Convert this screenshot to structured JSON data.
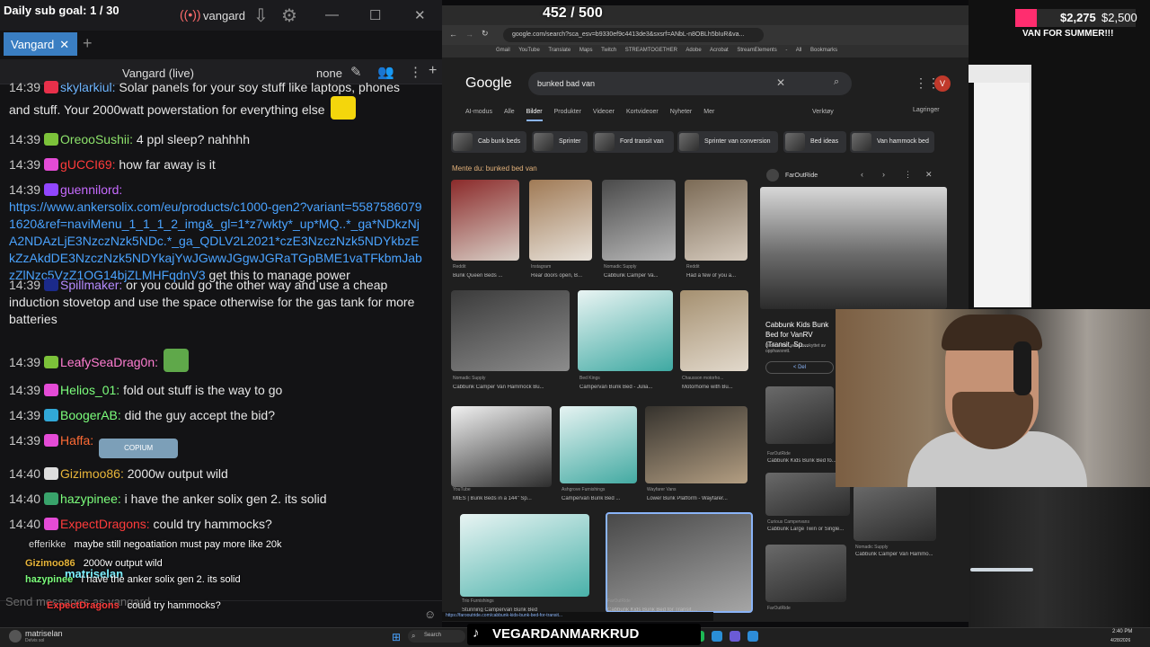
{
  "chatterino": {
    "title": "Daily sub goal: 1 / 30",
    "title_user": "vangard",
    "tab_label": "Vangard",
    "split_title": "Vangard (live)",
    "split_mode": "none",
    "input_placeholder": "Send messages as vangard"
  },
  "chat": [
    {
      "time": "14:39",
      "user": "skylarkiul",
      "user_color": "#6eb5ff",
      "text": "Solar panels for your soy stuff like laptops, phones and stuff. Your 2000watt powerstation for everything else",
      "badge_color": "#e8304a",
      "emote_color": "#f4d60c"
    },
    {
      "time": "14:39",
      "user": "OreooSushii",
      "user_color": "#8de26b",
      "text": "4 ppl sleep? nahhhh",
      "badge_color": "#7cc23a"
    },
    {
      "time": "14:39",
      "user": "gUCCI69",
      "user_color": "#ff3b3b",
      "text": "how far away is it",
      "badge_color": "#e44bd6"
    },
    {
      "time": "14:39",
      "user": "guennilord",
      "user_color": "#c66bff",
      "text": "",
      "link": "https://www.ankersolix.com/eu/products/c1000-gen2?variant=55875860791620&ref=naviMenu_1_1_1_2_img&_gl=1*z7wkty*_up*MQ..*_ga*NDkzNjA2NDAzLjE3NzczNzk5NDc.*_ga_QDLV2L2021*czE3NzczNzk5NDYkbzEkZzAkdDE3NzczNzk5NDYkajYwJGwwJGgwJGRaTGpBME1vaTFkbmJabzZlNzc5VzZ1OG14bjZLMHFqdnV3",
      "text_after": "get this to manage power",
      "badge_color": "#9146ff"
    },
    {
      "time": "14:39",
      "user": "Spillmaker",
      "user_color": "#b68bff",
      "text": "or you could go the other way and use a cheap induction stovetop and use the space otherwise for the gas tank for more batteries",
      "badge_color": "#1b2a8a"
    },
    {
      "time": "14:39",
      "user": "LeafySeaDrag0n",
      "user_color": "#ff7dd1",
      "text": "",
      "badge_color": "#7cc23a",
      "emote_color": "#5fa84a"
    },
    {
      "time": "14:39",
      "user": "Helios_01",
      "user_color": "#7cff7c",
      "text": "fold out stuff is the way to go",
      "badge_color": "#e44bd6"
    },
    {
      "time": "14:39",
      "user": "BoogerAB",
      "user_color": "#7cff7c",
      "text": "did the guy accept the bid?",
      "badge_color": "#31a8d8"
    },
    {
      "time": "14:39",
      "user": "Haffa",
      "user_color": "#ff6b35",
      "text": "",
      "badge_color": "#e44bd6",
      "emote_label": "COPIUM"
    },
    {
      "time": "14:40",
      "user": "Gizimoo86",
      "user_color": "#e8b53a",
      "text": "2000w output wild",
      "badge_color": "#dddddd"
    },
    {
      "time": "14:40",
      "user": "hazypinee",
      "user_color": "#7cff7c",
      "text": "i have the anker solix gen 2. its solid",
      "badge_color": "#39a36b"
    },
    {
      "time": "14:40",
      "user": "ExpectDragons",
      "user_color": "#ff3b3b",
      "text": "could try hammocks?",
      "badge_color": "#e44bd6"
    }
  ],
  "overlay_chat": [
    {
      "user": "efferikke",
      "text": "maybe still negoatiation must pay more like 20k"
    },
    {
      "user": "Gizimoo86",
      "text": "2000w output wild"
    },
    {
      "user": "hazypinee",
      "text": "I have the anker solix gen 2. its solid"
    },
    {
      "user": "ExpectDragons",
      "text": "could try hammocks?"
    }
  ],
  "overlay_top_user": "matriselan",
  "browser": {
    "counter": "452 / 500",
    "url": "google.com/search?sca_esv=b9330ef9c4413de3&sxsrf=ANbL-n8OBLh5bIuR&va...",
    "bookmarks": [
      "Gmail",
      "YouTube",
      "Translate",
      "Maps",
      "Twitch",
      "STREAMTOGETHER",
      "Adobe Acrobat",
      "StreamElements -",
      "All Bookmarks"
    ],
    "status_url": "https://farooutride.com/cabbunk-kids-bunk-bed-for-transit..."
  },
  "google": {
    "logo": "Google",
    "query": "bunked bad van",
    "tabs": [
      "AI-modus",
      "Alle",
      "Bilder",
      "Produkter",
      "Videoer",
      "Kortvideoer",
      "Nyheter",
      "Mer"
    ],
    "active_tab": "Bilder",
    "tools": "Verktøy",
    "save": "Lagringer",
    "chips": [
      "Cab bunk beds",
      "Sprinter",
      "Ford transit van",
      "Sprinter van conversion",
      "Bed ideas",
      "Van hammock bed"
    ],
    "mention": "Mente du: bunked bed van",
    "results": [
      {
        "source": "Reddit",
        "caption": "Bunk Queen Beds ..."
      },
      {
        "source": "Instagram",
        "caption": "Rear doors open, B..."
      },
      {
        "source": "Nomadic Supply",
        "caption": "Cabbunk Camper Va..."
      },
      {
        "source": "Reddit",
        "caption": "Had a few of you a..."
      },
      {
        "source": "Nomadic Supply",
        "caption": "Cabbunk Camper Van Hammock Bu..."
      },
      {
        "source": "Bed Kings",
        "caption": "Campervan Bunk Bed - Julia..."
      },
      {
        "source": "Chausson motorho...",
        "caption": "Motorhome with Bu..."
      },
      {
        "source": "YouTube",
        "caption": "MIES | Bunk Beds in a 144\" Sp..."
      },
      {
        "source": "Ashgrove Furnishings",
        "caption": "Campervan Bunk Bed ..."
      },
      {
        "source": "Wayfarer Vans",
        "caption": "Lower Bunk Platform - Wayfarer..."
      },
      {
        "source": "Trio Furnishings",
        "caption": "Stunning Campervan Bunk Bed"
      },
      {
        "source": "FarOutRide",
        "caption": "Cabbunk Kids Bunk Bed for Transit,..."
      }
    ],
    "panel": {
      "source": "FarOutRide",
      "title": "Cabbunk Kids Bunk Bed for VanRV (Transit, Sp...",
      "note": "Bildene kan være beskyttet av opphavsrett.",
      "share": "Del",
      "related": [
        {
          "source": "FarOutRide",
          "caption": "Cabbunk Kids Bunk Bed fo..."
        },
        {
          "source": "Curious Campervans",
          "caption": "Cabbunk Large Twin or Single..."
        },
        {
          "source": "Nomadic Supply",
          "caption": "Cabbunk Camper Van Hammo..."
        },
        {
          "source": "FarOutRide",
          "caption": ""
        }
      ]
    }
  },
  "stream_overlay": {
    "goal_amount": "$2,275",
    "goal_target": "$2,500",
    "goal_label": "VAN FOR SUMMER!!!"
  },
  "taskbar": {
    "user": "matriselan",
    "user_sub": "Delvis sol",
    "search": "Search",
    "time": "2:40 PM",
    "date": "4/28/2026",
    "brand": "VEGARDANMARKRUD"
  }
}
